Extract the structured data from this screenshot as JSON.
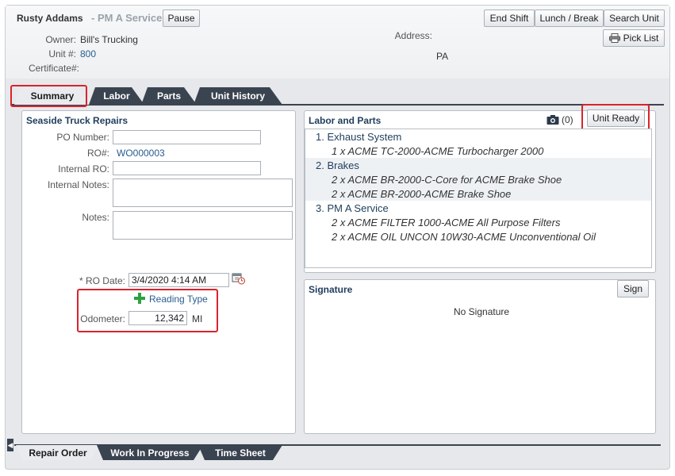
{
  "header": {
    "name": "Rusty Addams",
    "service": "- PM A Service",
    "pause_label": "Pause",
    "end_shift_label": "End Shift",
    "lunch_break_label": "Lunch / Break",
    "search_unit_label": "Search Unit",
    "pick_list_label": "Pick List",
    "owner_label": "Owner:",
    "owner_value": "Bill's Trucking",
    "unit_label": "Unit #:",
    "unit_value": "800",
    "certificate_label": "Certificate#:",
    "address_label": "Address:",
    "address_value": "PA"
  },
  "tabs": [
    {
      "label": "Summary"
    },
    {
      "label": "Labor"
    },
    {
      "label": "Parts"
    },
    {
      "label": "Unit History"
    }
  ],
  "left_panel": {
    "title": "Seaside Truck Repairs",
    "po_label": "PO Number:",
    "po_value": "",
    "ro_label": "RO#:",
    "ro_value": "WO000003",
    "internal_ro_label": "Internal RO:",
    "internal_ro_value": "",
    "internal_notes_label": "Internal Notes:",
    "notes_label": "Notes:",
    "ro_date_label": "* RO Date:",
    "ro_date_value": "3/4/2020 4:14 AM",
    "reading_type_label": "Reading Type",
    "odometer_label": "Odometer:",
    "odometer_value": "12,342",
    "odometer_unit": "MI"
  },
  "labor_parts": {
    "title": "Labor and Parts",
    "photo_count": "(0)",
    "unit_ready_label": "Unit Ready",
    "rows": [
      {
        "text": "1. Exhaust System",
        "kind": "group"
      },
      {
        "text": "1 x  ACME TC-2000-ACME Turbocharger 2000",
        "kind": "item"
      },
      {
        "text": "2. Brakes",
        "kind": "group"
      },
      {
        "text": "2 x  ACME BR-2000-C-Core for ACME Brake Shoe",
        "kind": "item"
      },
      {
        "text": "2 x  ACME BR-2000-ACME Brake Shoe",
        "kind": "item"
      },
      {
        "text": "3. PM A Service",
        "kind": "group"
      },
      {
        "text": "2 x  ACME FILTER 1000-ACME All Purpose Filters",
        "kind": "item"
      },
      {
        "text": "2 x  ACME OIL UNCON 10W30-ACME Unconventional Oil",
        "kind": "item"
      }
    ]
  },
  "signature": {
    "title": "Signature",
    "sign_label": "Sign",
    "status": "No Signature"
  },
  "bottom_tabs": [
    {
      "label": "Repair Order"
    },
    {
      "label": "Work In Progress"
    },
    {
      "label": "Time Sheet"
    }
  ],
  "colors": {
    "accent_red": "#d9232d",
    "tab_dark": "#3a4451",
    "title_blue": "#1f3d5c"
  }
}
